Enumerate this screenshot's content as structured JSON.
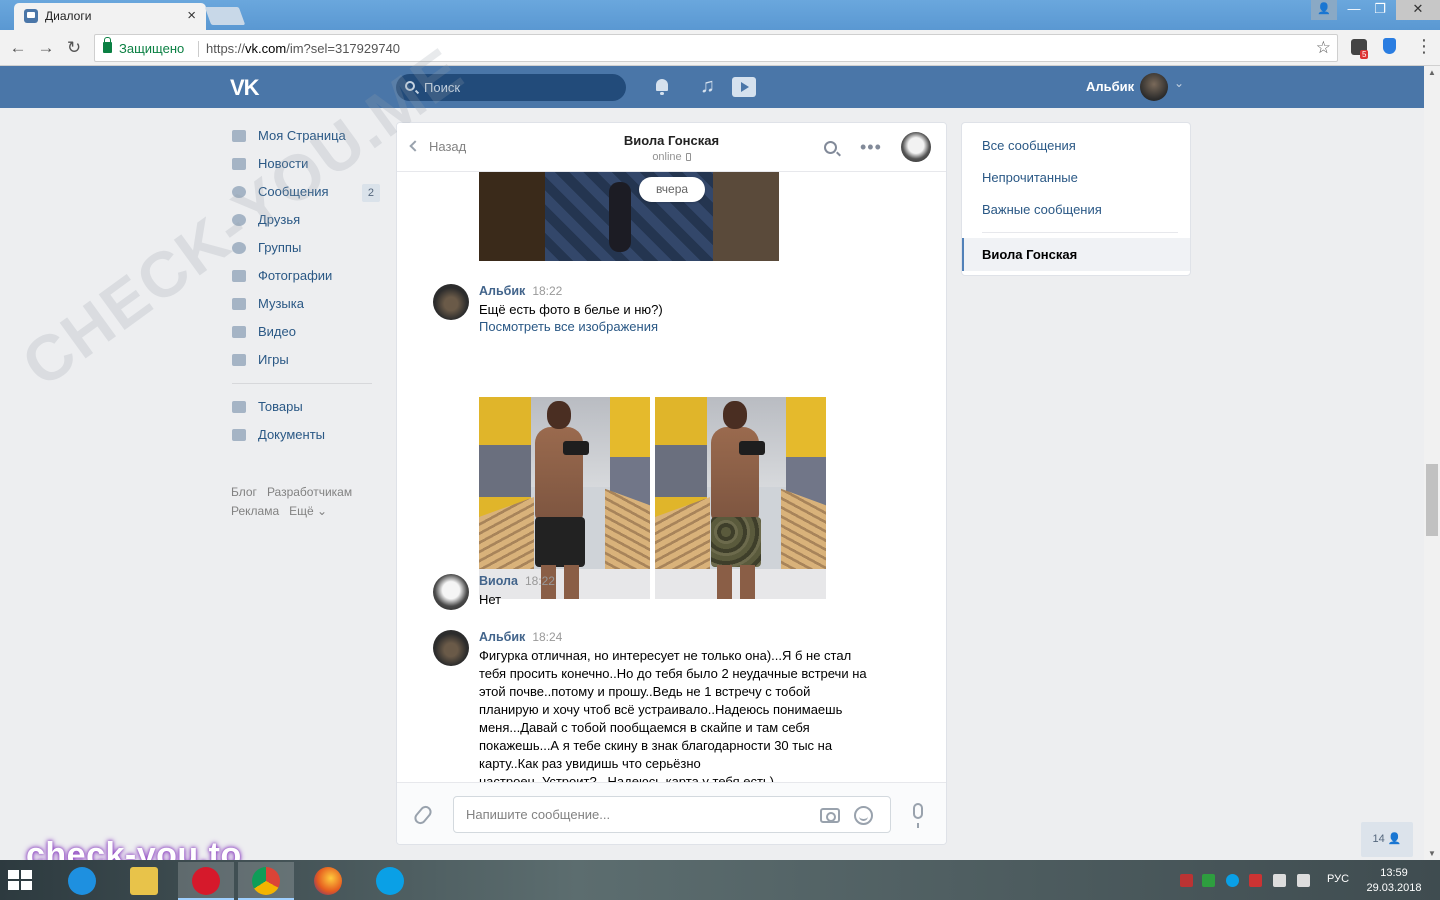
{
  "browser": {
    "tab_title": "Диалоги",
    "secure_label": "Защищено",
    "url_prefix": "https://",
    "url_host": "vk.com",
    "url_path": "/im?sel=317929740",
    "ext_badge": "5"
  },
  "header": {
    "logo": "VK",
    "search_placeholder": "Поиск",
    "user_name": "Альбик"
  },
  "left_menu": {
    "items": [
      {
        "label": "Моя Страница",
        "icon": "home-icon"
      },
      {
        "label": "Новости",
        "icon": "news-icon"
      },
      {
        "label": "Сообщения",
        "icon": "messages-icon",
        "count": "2"
      },
      {
        "label": "Друзья",
        "icon": "friends-icon"
      },
      {
        "label": "Группы",
        "icon": "groups-icon"
      },
      {
        "label": "Фотографии",
        "icon": "photos-icon"
      },
      {
        "label": "Музыка",
        "icon": "music-icon"
      },
      {
        "label": "Видео",
        "icon": "video-icon"
      },
      {
        "label": "Игры",
        "icon": "games-icon"
      }
    ],
    "items2": [
      {
        "label": "Товары",
        "icon": "goods-icon"
      },
      {
        "label": "Документы",
        "icon": "documents-icon"
      }
    ],
    "footer": [
      "Блог",
      "Разработчикам",
      "Реклама",
      "Ещё ⌄"
    ]
  },
  "chat": {
    "back_label": "Назад",
    "peer_name": "Виола Гонская",
    "peer_status": "online",
    "day_divider": "вчера",
    "messages": [
      {
        "author": "Альбик",
        "time": "18:22",
        "text": "Ещё есть фото в белье и ню?)",
        "link": "Посмотреть все изображения"
      },
      {
        "author": "Виола",
        "time": "18:22",
        "text": "Нет"
      },
      {
        "author": "Альбик",
        "time": "18:24",
        "text": "Фигурка отличная, но интересует не только она)...Я б не стал тебя просить конечно..Но до тебя было 2 неудачные встречи на этой почве..потому и прошу..Ведь не 1 встречу с тобой планирую и хочу чтоб всё устраивало..Надеюсь понимаешь меня...Давай с тобой пообщаемся в скайпе и там себя покажешь...А я тебе скину в знак благодарности 30 тыс на карту..Как раз увидишь что серьёзно настроен..Устроит?...Надеюсь карта у тебя есть)"
      }
    ],
    "composer_placeholder": "Напишите сообщение..."
  },
  "right_menu": {
    "items": [
      "Все сообщения",
      "Непрочитанные",
      "Важные сообщения"
    ],
    "active": "Виола Гонская"
  },
  "online_count": "14",
  "watermarks": {
    "diagonal": "CHECK-YOU.ME",
    "corner": "check-you.to"
  },
  "taskbar": {
    "lang": "РУС",
    "time": "13:59",
    "date": "29.03.2018"
  },
  "colors": {
    "vk_blue": "#4a76a8",
    "link": "#2a5885",
    "author": "#42648b",
    "page_bg": "#edeef0"
  }
}
